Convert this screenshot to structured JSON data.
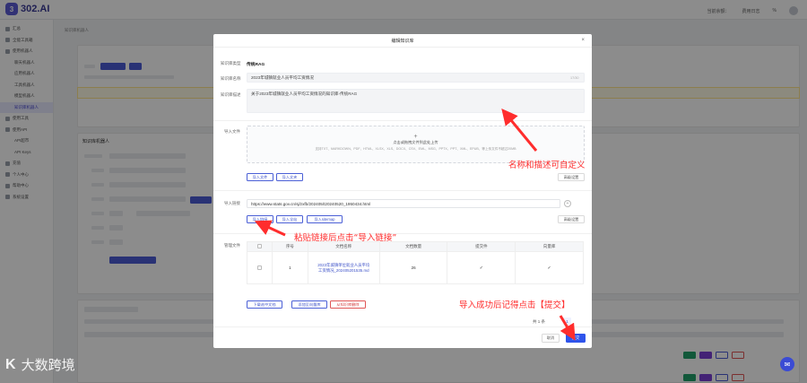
{
  "app": {
    "brand": "302.AI",
    "top_info": "当前余额：",
    "top_item_2": "费用日志",
    "top_item_3": "%",
    "sidebar": [
      {
        "label": "汇总"
      },
      {
        "label": "全能工具箱"
      },
      {
        "label": "使用机器人"
      },
      {
        "label": "聊天机器人",
        "sub": true
      },
      {
        "label": "应用机器人",
        "sub": true
      },
      {
        "label": "工具机器人",
        "sub": true
      },
      {
        "label": "模型机器人",
        "sub": true
      },
      {
        "label": "知识库机器人",
        "sub": true,
        "active": true
      },
      {
        "label": "使用工具"
      },
      {
        "label": "使用API"
      },
      {
        "label": "API超市",
        "sub": true
      },
      {
        "label": "API Keys",
        "sub": true
      },
      {
        "label": "充值"
      },
      {
        "label": "个人中心"
      },
      {
        "label": "帮助中心"
      },
      {
        "label": "系统设置"
      }
    ],
    "breadcrumb": "知识库机器人",
    "section_title": "知识库机器人"
  },
  "modal": {
    "title": "编辑知识库",
    "close_icon": "×",
    "type_label": "知识库类型",
    "type_value": "传统RAG",
    "name_label": "知识库名称",
    "name_value": "2023年城镇就业人员平均工资情况",
    "name_counter": "17/30",
    "desc_label": "知识库描述",
    "desc_value": "关于2023年城镇就业人员平均工资情况的知识库-传统RAG",
    "import_file_label": "导入文件",
    "dropzone_plus": "+",
    "dropzone_main": "点击或拖拽文件到此处上传",
    "dropzone_sub": "支持TXT、MARKDOWN、PDF、HTML、XLSX、XLS、DOCX、CSV、EML、MSG、PPTX、PPT、XML、EPUB、等上传文件不超过20MB",
    "btn_import_file": "导入文件",
    "btn_import_folder": "导入文夹",
    "btn_advanced_1": "高级设置",
    "import_link_label": "导入链接",
    "link_value": "https://www.stats.gov.cn/sj/zxfb/202405/t20240520_1950434.html",
    "btn_import_link": "导入链接",
    "btn_import_site": "导入全站",
    "btn_import_sitemap": "导入sitemap",
    "btn_advanced_2": "高级设置",
    "manage_label": "管理文件",
    "table_headers": [
      "",
      "序号",
      "文档名称",
      "文档数量",
      "提交件",
      "向量库"
    ],
    "table_rows": [
      {
        "index": "1",
        "name": "2023年城镇单位就业人员平均工资情况_202405201535.md",
        "count": "26",
        "submitted": "✓",
        "vector": "✓"
      }
    ],
    "pager_total": "共 1 条",
    "pager_page": "1",
    "btn_download": "下载选中文档",
    "btn_add_to_kb": "添加至向量库",
    "btn_delete": "从知识库删除",
    "btn_cancel": "取消",
    "btn_submit": "提交"
  },
  "annotations": {
    "note_name_desc": "名称和描述可自定义",
    "note_paste_link": "粘贴链接后点击“导入链接”",
    "note_submit": "导入成功后记得点击【提交】"
  },
  "watermark": {
    "logo": "K",
    "text": "大数跨境"
  },
  "colors": {
    "accent": "#2f54eb",
    "annotation": "#ff2d2d"
  }
}
